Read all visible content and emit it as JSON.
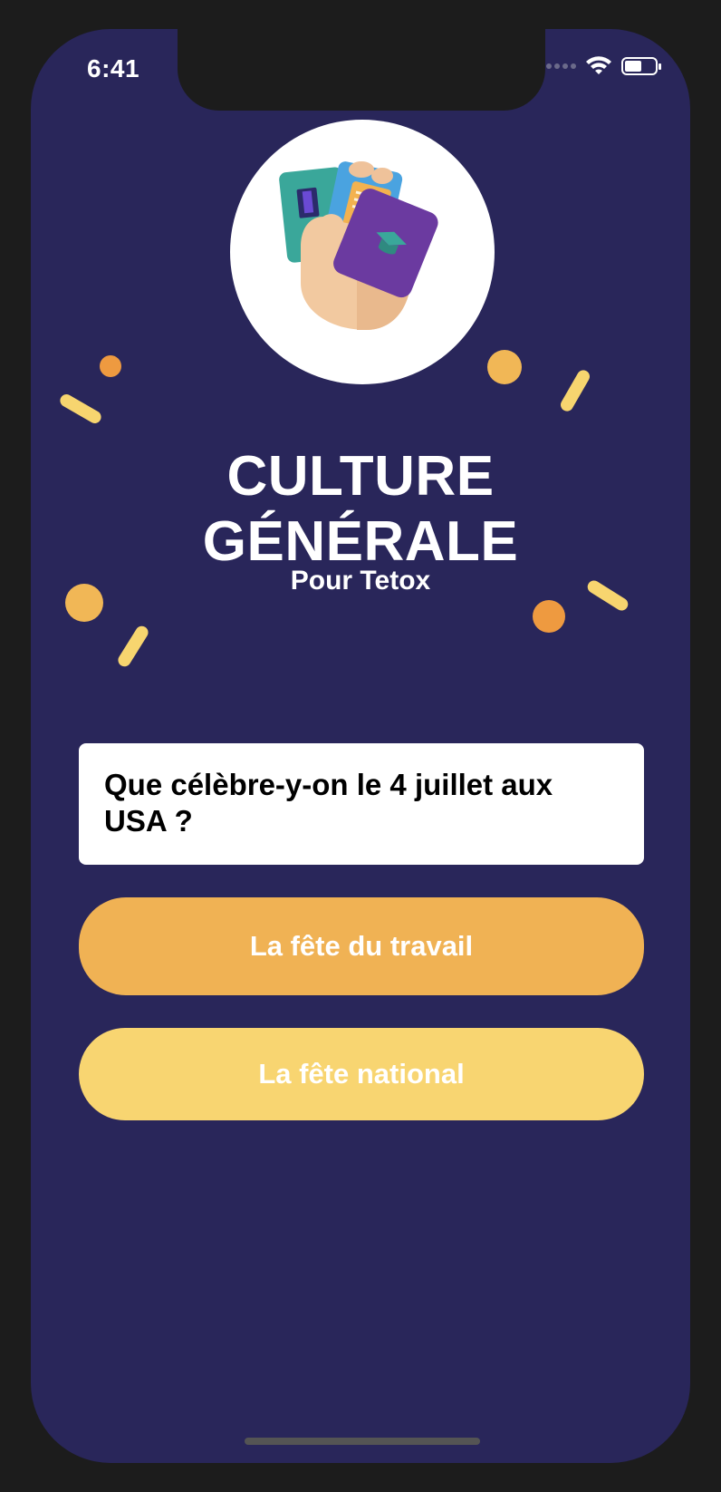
{
  "status_bar": {
    "time": "6:41"
  },
  "app": {
    "title_line1": "CULTURE",
    "title_line2": "GÉNÉRALE",
    "subtitle": "Pour Tetox"
  },
  "question": {
    "text": "Que célèbre-y-on le 4 juillet aux USA ?"
  },
  "answers": [
    {
      "label": "La fête du travail",
      "color": "#f0b254"
    },
    {
      "label": "La fête national",
      "color": "#f8d571"
    }
  ],
  "colors": {
    "background": "#29265a",
    "confetti_orange": "#ee9a40",
    "confetti_gold": "#f1b756",
    "confetti_yellow": "#f7d56f"
  },
  "icons": {
    "logo": "hand-holding-cards-icon",
    "wifi": "wifi-icon",
    "battery": "battery-icon",
    "signal": "cellular-signal-icon"
  }
}
